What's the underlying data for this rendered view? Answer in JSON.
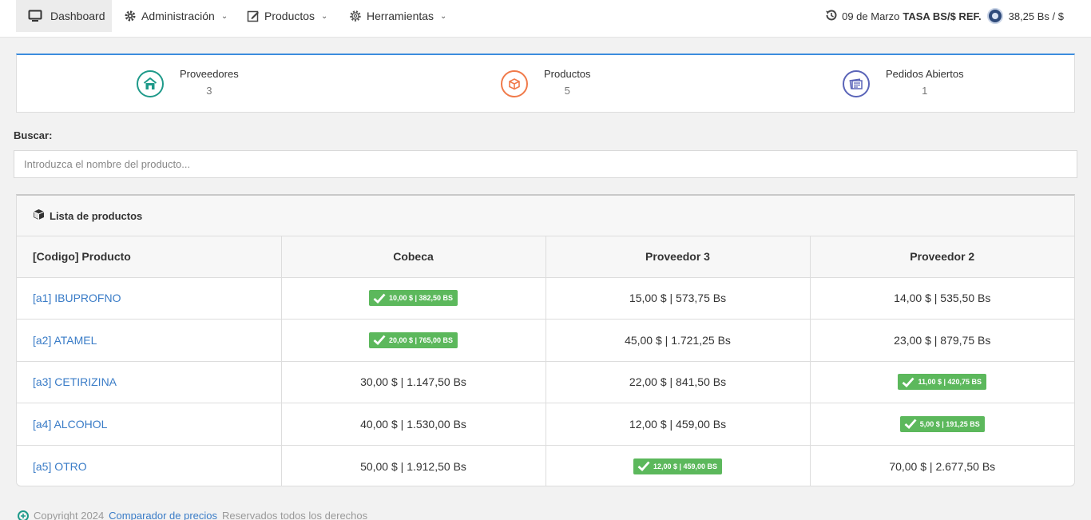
{
  "nav": {
    "dashboard": "Dashboard",
    "admin": "Administración",
    "products": "Productos",
    "tools": "Herramientas",
    "date": "09 de Marzo",
    "rate_label": "TASA BS/$ REF.",
    "rate_value": "38,25 Bs / $"
  },
  "stats": [
    {
      "label": "Proveedores",
      "value": "3",
      "color": "#1f9a8a",
      "icon": "store-icon"
    },
    {
      "label": "Productos",
      "value": "5",
      "color": "#f07a4a",
      "icon": "box-icon"
    },
    {
      "label": "Pedidos Abiertos",
      "value": "1",
      "color": "#5a64b8",
      "icon": "orders-icon"
    }
  ],
  "search": {
    "label": "Buscar:",
    "placeholder": "Introduzca el nombre del producto..."
  },
  "panel": {
    "title": "Lista de productos",
    "columns": [
      "[Codigo] Producto",
      "Cobeca",
      "Proveedor 3",
      "Proveedor 2"
    ],
    "rows": [
      {
        "product": "[a1] IBUPROFNO",
        "cells": [
          "10,00 $ | 382,50 BS",
          "15,00 $ | 573,75 Bs",
          "14,00 $ | 535,50 Bs"
        ],
        "best": 0
      },
      {
        "product": "[a2] ATAMEL",
        "cells": [
          "20,00 $ | 765,00 BS",
          "45,00 $ | 1.721,25 Bs",
          "23,00 $ | 879,75 Bs"
        ],
        "best": 0
      },
      {
        "product": "[a3] CETIRIZINA",
        "cells": [
          "30,00 $ | 1.147,50 Bs",
          "22,00 $ | 841,50 Bs",
          "11,00 $ | 420,75 BS"
        ],
        "best": 2
      },
      {
        "product": "[a4] ALCOHOL",
        "cells": [
          "40,00 $ | 1.530,00 Bs",
          "12,00 $ | 459,00 Bs",
          "5,00 $ | 191,25 BS"
        ],
        "best": 2
      },
      {
        "product": "[a5] OTRO",
        "cells": [
          "50,00 $ | 1.912,50 Bs",
          "12,00 $ | 459,00 BS",
          "70,00 $ | 2.677,50 Bs"
        ],
        "best": 1
      }
    ]
  },
  "footer": {
    "copyright": "Copyright 2024",
    "link": "Comparador de precios",
    "rights": "Reservados todos los derechos"
  },
  "colors": {
    "accent": "#3c8dde",
    "best_badge": "#5cb85c",
    "link": "#3a7cc7"
  }
}
